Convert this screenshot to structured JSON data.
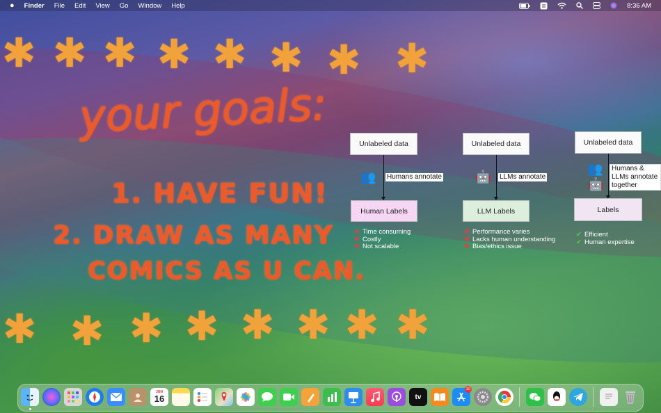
{
  "menubar": {
    "apple": "",
    "app_name": "Finder",
    "menus": [
      "File",
      "Edit",
      "View",
      "Go",
      "Window",
      "Help"
    ],
    "clock": "8:36 AM"
  },
  "canvas": {
    "line1": "your goals:",
    "line2": "1. HAVE FUN!",
    "line3": "2. DRAW AS MANY",
    "line4": "COMICS AS U CAN."
  },
  "diagram": {
    "columns": [
      {
        "source": "Unlabeled data",
        "action": "Humans annotate",
        "result": "Human Labels",
        "result_color": "#f6d6f4",
        "notes": [
          "Time consuming",
          "Costly",
          "Not scalable"
        ],
        "note_kind": "cross"
      },
      {
        "source": "Unlabeled data",
        "action": "LLMs annotate",
        "result": "LLM Labels",
        "result_color": "#dcefdc",
        "notes": [
          "Performance varies",
          "Lacks human understanding",
          "Bias/ethics issue"
        ],
        "note_kind": "cross"
      },
      {
        "source": "Unlabeled data",
        "action_lines": [
          "Humans &",
          "LLMs annotate",
          "together"
        ],
        "result": "Labels",
        "result_color": "#f1e4f3",
        "notes": [
          "Efficient",
          "Human expertise"
        ],
        "note_kind": "check"
      }
    ]
  },
  "dock": {
    "calendar_month": "JUN",
    "calendar_day": "16",
    "appstore_badge": "10",
    "tv_label": "tv",
    "icons": [
      "finder-icon",
      "siri-icon",
      "launchpad-icon",
      "safari-icon",
      "mail-icon",
      "contacts-icon",
      "calendar-icon",
      "notes-icon",
      "reminders-icon",
      "maps-icon",
      "photos-icon",
      "messages-icon",
      "facetime-icon",
      "pages-icon",
      "numbers-icon",
      "keynote-icon",
      "music-icon",
      "podcasts-icon",
      "appletv-icon",
      "books-icon",
      "appstore-icon",
      "system-settings-icon",
      "chrome-icon",
      "wechat-icon",
      "qq-icon",
      "telegram-icon",
      "document-icon",
      "trash-icon"
    ]
  }
}
